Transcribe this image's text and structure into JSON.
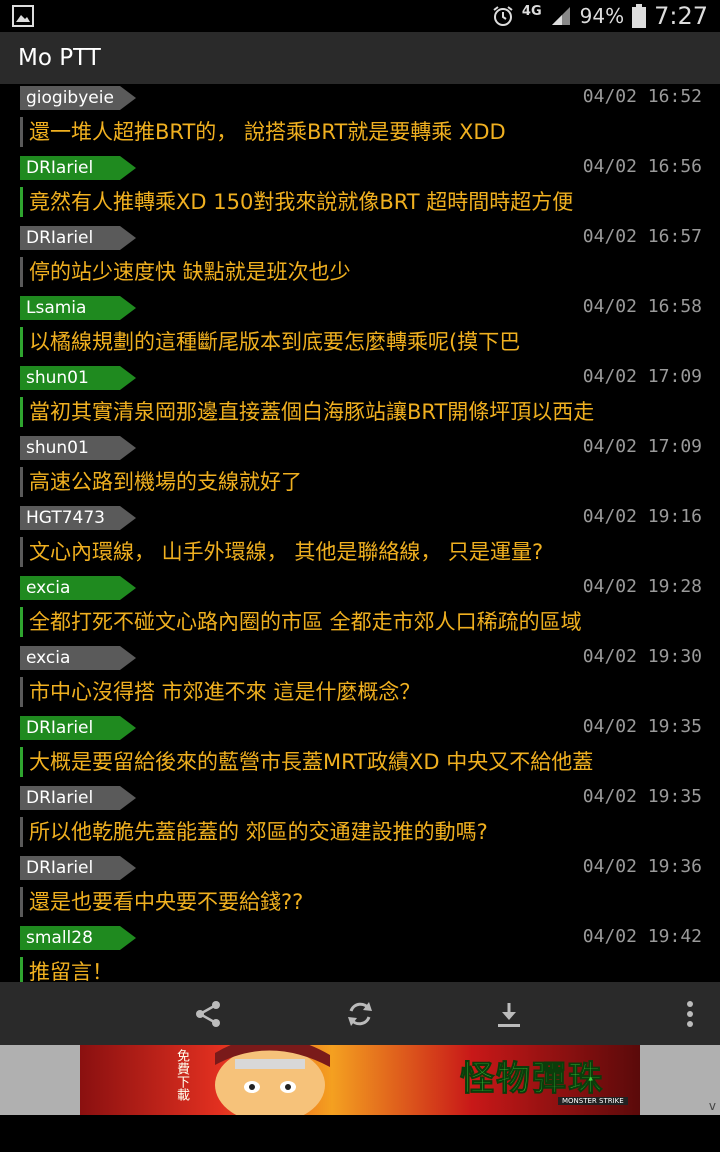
{
  "status_bar": {
    "network": "4G",
    "battery": "94%",
    "time": "7:27"
  },
  "app": {
    "title": "Mo PTT"
  },
  "comments": [
    {
      "user": "giogibyeie",
      "time": "04/02 16:52",
      "text": "還一堆人超推BRT的， 說搭乘BRT就是要轉乘 XDD",
      "style": "gray"
    },
    {
      "user": "DRIariel",
      "time": "04/02 16:56",
      "text": "竟然有人推轉乘XD 150對我來說就像BRT 超時間時超方便",
      "style": "green"
    },
    {
      "user": "DRIariel",
      "time": "04/02 16:57",
      "text": "停的站少速度快 缺點就是班次也少",
      "style": "gray"
    },
    {
      "user": "Lsamia",
      "time": "04/02 16:58",
      "text": "以橘線規劃的這種斷尾版本到底要怎麼轉乘呢(摸下巴",
      "style": "green"
    },
    {
      "user": "shun01",
      "time": "04/02 17:09",
      "text": "當初其實清泉岡那邊直接蓋個白海豚站讓BRT開條坪頂以西走",
      "style": "green"
    },
    {
      "user": "shun01",
      "time": "04/02 17:09",
      "text": "高速公路到機場的支線就好了",
      "style": "gray"
    },
    {
      "user": "HGT7473",
      "time": "04/02 19:16",
      "text": "文心內環線， 山手外環線， 其他是聯絡線， 只是運量?",
      "style": "gray"
    },
    {
      "user": "excia",
      "time": "04/02 19:28",
      "text": "全都打死不碰文心路內圈的市區 全都走市郊人口稀疏的區域",
      "style": "green"
    },
    {
      "user": "excia",
      "time": "04/02 19:30",
      "text": "市中心沒得搭 市郊進不來 這是什麼概念？",
      "style": "gray"
    },
    {
      "user": "DRIariel",
      "time": "04/02 19:35",
      "text": "大概是要留給後來的藍營市長蓋MRT政績XD 中央又不給他蓋",
      "style": "green"
    },
    {
      "user": "DRIariel",
      "time": "04/02 19:35",
      "text": "所以他乾脆先蓋能蓋的 郊區的交通建設推的動嗎?",
      "style": "gray"
    },
    {
      "user": "DRIariel",
      "time": "04/02 19:36",
      "text": "還是也要看中央要不要給錢??",
      "style": "gray"
    },
    {
      "user": "small28",
      "time": "04/02 19:42",
      "text": "推留言！",
      "style": "green"
    }
  ],
  "toolbar": {
    "icons": [
      "share-icon",
      "refresh-icon",
      "download-icon",
      "more-vert-icon"
    ]
  },
  "ad": {
    "title": "怪物彈珠",
    "subtitle": "MONSTER STRIKE",
    "side": "免費下載",
    "close": "v"
  },
  "colors": {
    "accent_green": "#1f8a1f",
    "gray_tag": "#5a5a5a",
    "content_text": "#f0b020"
  }
}
